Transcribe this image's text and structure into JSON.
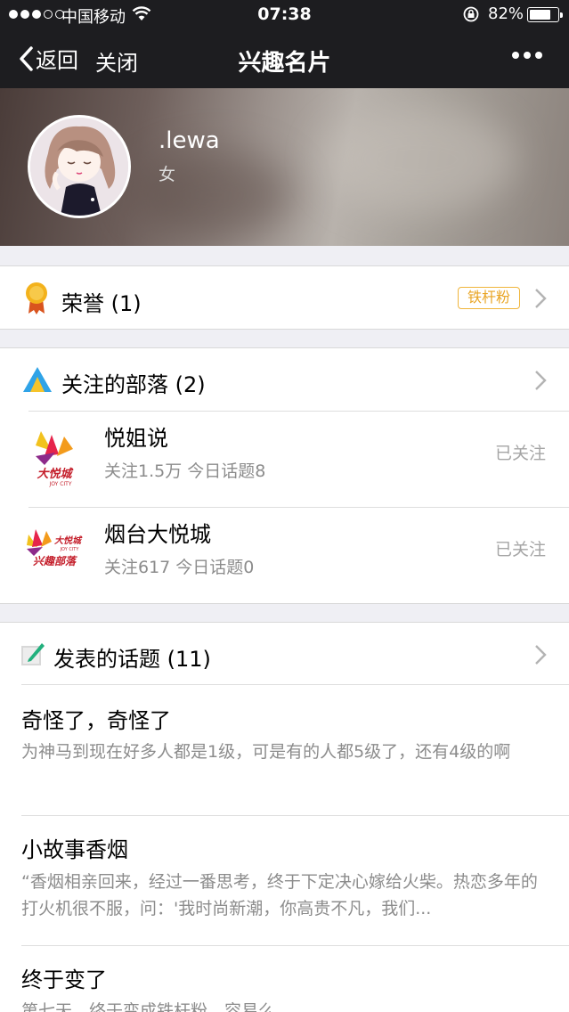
{
  "status_bar": {
    "carrier": "中国移动",
    "time": "07:38",
    "battery_percent": "82%",
    "battery_level": 0.82
  },
  "nav": {
    "back_label": "返回",
    "close_label": "关闭",
    "title": "兴趣名片"
  },
  "profile": {
    "username": ".lewa",
    "gender": "女"
  },
  "honor": {
    "label": "荣誉 (1)",
    "badge": "铁杆粉",
    "badge_color": "#f0b53b"
  },
  "tribes": {
    "label": "关注的部落 (2)",
    "items": [
      {
        "name": "悦姐说",
        "meta": "关注1.5万  今日话题8",
        "status": "已关注",
        "logo_text": "大悦城",
        "logo_sub": "JOY CITY"
      },
      {
        "name": "烟台大悦城",
        "meta": "关注617  今日话题0",
        "status": "已关注",
        "logo_text": "大悦城",
        "logo_sub": "JOY CITY",
        "logo_tag": "兴趣部落"
      }
    ]
  },
  "topics": {
    "label": "发表的话题 (11)",
    "items": [
      {
        "title": "奇怪了，奇怪了",
        "body": "为神马到现在好多人都是1级，可是有的人都5级了，还有4级的啊"
      },
      {
        "title": "小故事香烟",
        "body": "“香烟相亲回来，经过一番思考，终于下定决心嫁给火柴。热恋多年的打火机很不服，问：'我时尚新潮，你高贵不凡，我们..."
      },
      {
        "title": "终于变了",
        "body": "第七天，终于变成铁杆粉，容易么"
      }
    ]
  }
}
